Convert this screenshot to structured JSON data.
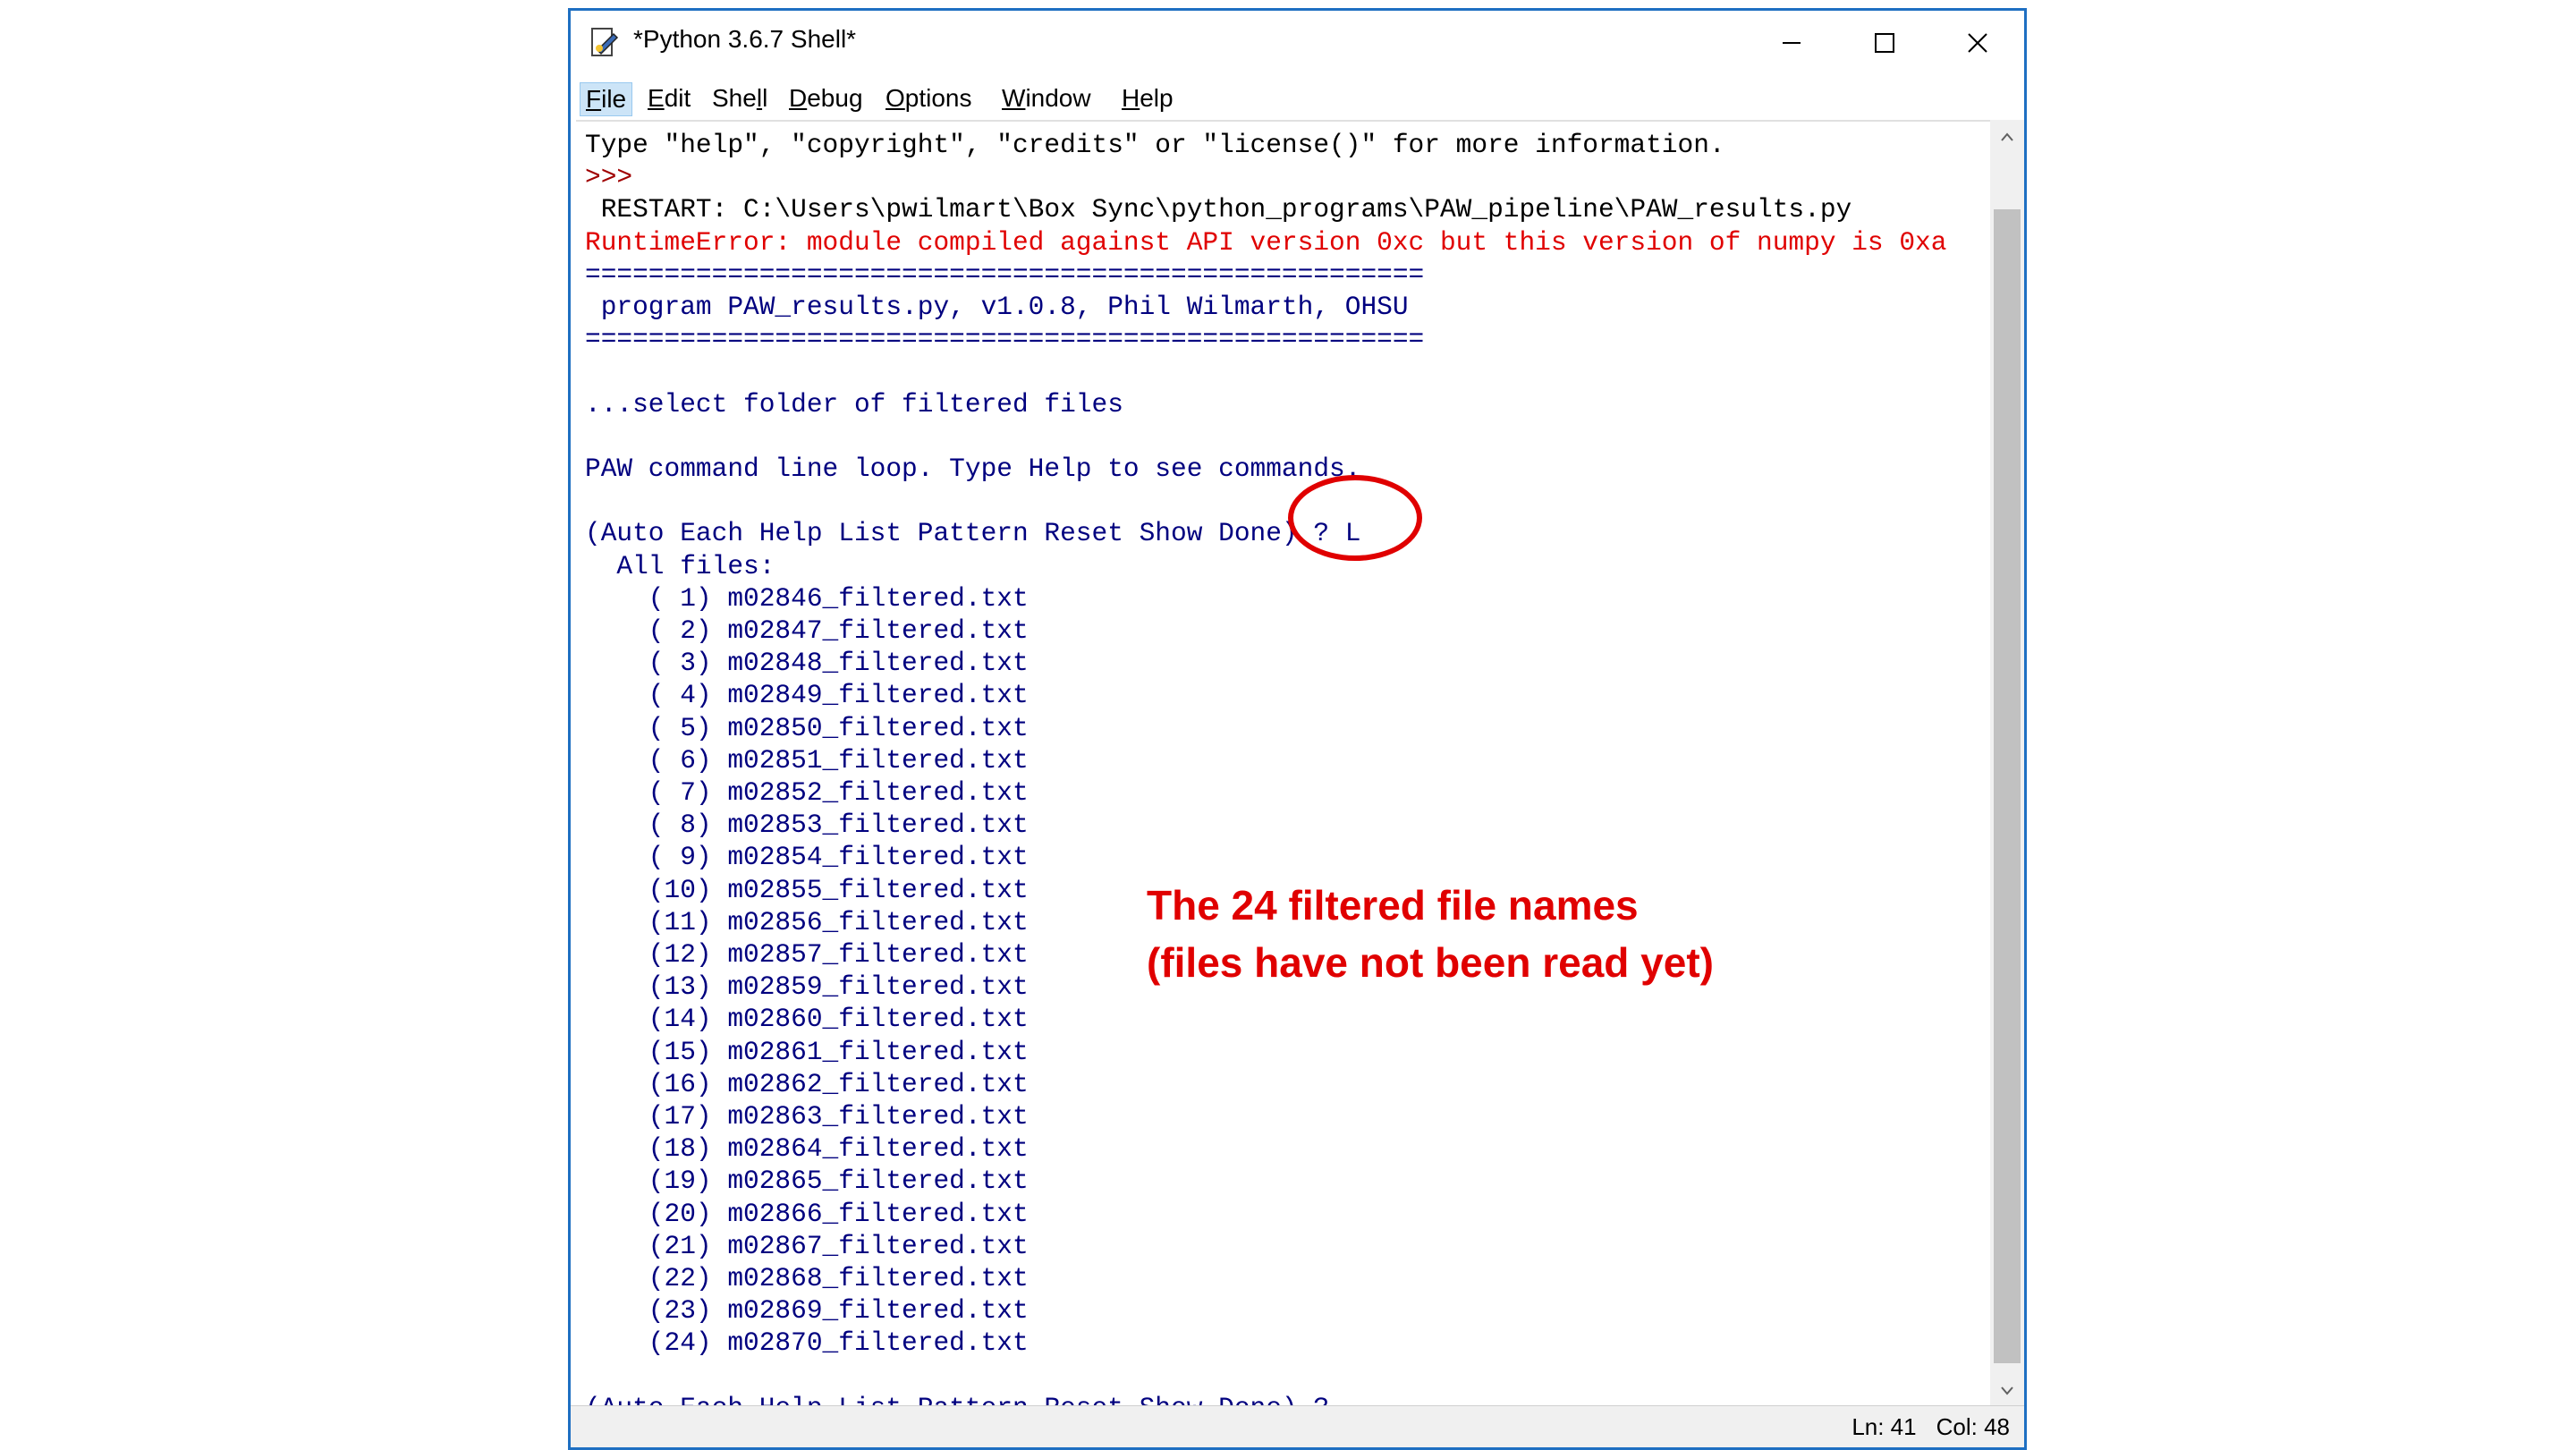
{
  "window": {
    "title": "*Python 3.6.7 Shell*",
    "controls": {
      "minimize": "–",
      "maximize": "☐",
      "close": "✕"
    }
  },
  "menubar": {
    "items": [
      {
        "label": "File",
        "mnemonic": "F"
      },
      {
        "label": "Edit",
        "mnemonic": "E"
      },
      {
        "label": "Shell",
        "mnemonic": "l"
      },
      {
        "label": "Debug",
        "mnemonic": "D"
      },
      {
        "label": "Options",
        "mnemonic": "O"
      },
      {
        "label": "Window",
        "mnemonic": "W"
      },
      {
        "label": "Help",
        "mnemonic": "H"
      }
    ]
  },
  "shell": {
    "lines": [
      {
        "text": "Type \"help\", \"copyright\", \"credits\" or \"license()\" for more information.",
        "color": "black"
      },
      {
        "text": ">>> ",
        "color": "darkred"
      },
      {
        "text": " RESTART: C:\\Users\\pwilmart\\Box Sync\\python_programs\\PAW_pipeline\\PAW_results.py",
        "color": "black"
      },
      {
        "text": "RuntimeError: module compiled against API version 0xc but this version of numpy is 0xa",
        "color": "red"
      },
      {
        "text": "=====================================================",
        "color": "blue"
      },
      {
        "text": " program PAW_results.py, v1.0.8, Phil Wilmarth, OHSU",
        "color": "blue"
      },
      {
        "text": "=====================================================",
        "color": "blue"
      },
      {
        "text": "",
        "color": "blue"
      },
      {
        "text": "...select folder of filtered files",
        "color": "blue"
      },
      {
        "text": "",
        "color": "blue"
      },
      {
        "text": "PAW command line loop. Type Help to see commands.",
        "color": "blue"
      },
      {
        "text": "",
        "color": "blue"
      },
      {
        "text": "(Auto Each Help List Pattern Reset Show Done) ? L",
        "color": "blue"
      },
      {
        "text": "  All files:",
        "color": "blue"
      },
      {
        "text": "    ( 1) m02846_filtered.txt",
        "color": "blue"
      },
      {
        "text": "    ( 2) m02847_filtered.txt",
        "color": "blue"
      },
      {
        "text": "    ( 3) m02848_filtered.txt",
        "color": "blue"
      },
      {
        "text": "    ( 4) m02849_filtered.txt",
        "color": "blue"
      },
      {
        "text": "    ( 5) m02850_filtered.txt",
        "color": "blue"
      },
      {
        "text": "    ( 6) m02851_filtered.txt",
        "color": "blue"
      },
      {
        "text": "    ( 7) m02852_filtered.txt",
        "color": "blue"
      },
      {
        "text": "    ( 8) m02853_filtered.txt",
        "color": "blue"
      },
      {
        "text": "    ( 9) m02854_filtered.txt",
        "color": "blue"
      },
      {
        "text": "    (10) m02855_filtered.txt",
        "color": "blue"
      },
      {
        "text": "    (11) m02856_filtered.txt",
        "color": "blue"
      },
      {
        "text": "    (12) m02857_filtered.txt",
        "color": "blue"
      },
      {
        "text": "    (13) m02859_filtered.txt",
        "color": "blue"
      },
      {
        "text": "    (14) m02860_filtered.txt",
        "color": "blue"
      },
      {
        "text": "    (15) m02861_filtered.txt",
        "color": "blue"
      },
      {
        "text": "    (16) m02862_filtered.txt",
        "color": "blue"
      },
      {
        "text": "    (17) m02863_filtered.txt",
        "color": "blue"
      },
      {
        "text": "    (18) m02864_filtered.txt",
        "color": "blue"
      },
      {
        "text": "    (19) m02865_filtered.txt",
        "color": "blue"
      },
      {
        "text": "    (20) m02866_filtered.txt",
        "color": "blue"
      },
      {
        "text": "    (21) m02867_filtered.txt",
        "color": "blue"
      },
      {
        "text": "    (22) m02868_filtered.txt",
        "color": "blue"
      },
      {
        "text": "    (23) m02869_filtered.txt",
        "color": "blue"
      },
      {
        "text": "    (24) m02870_filtered.txt",
        "color": "blue"
      },
      {
        "text": "",
        "color": "blue"
      },
      {
        "text": "(Auto Each Help List Pattern Reset Show Done) ? ",
        "color": "blue"
      }
    ]
  },
  "statusbar": {
    "ln": "Ln: 41",
    "col": "Col: 48"
  },
  "annotation": {
    "line1": "The 24 filtered file names",
    "line2": "(files have not been read yet)",
    "color": "#e00000"
  },
  "colors": {
    "black": "#000000",
    "blue": "#00007f",
    "red": "#e00000",
    "darkred": "#a00000"
  }
}
